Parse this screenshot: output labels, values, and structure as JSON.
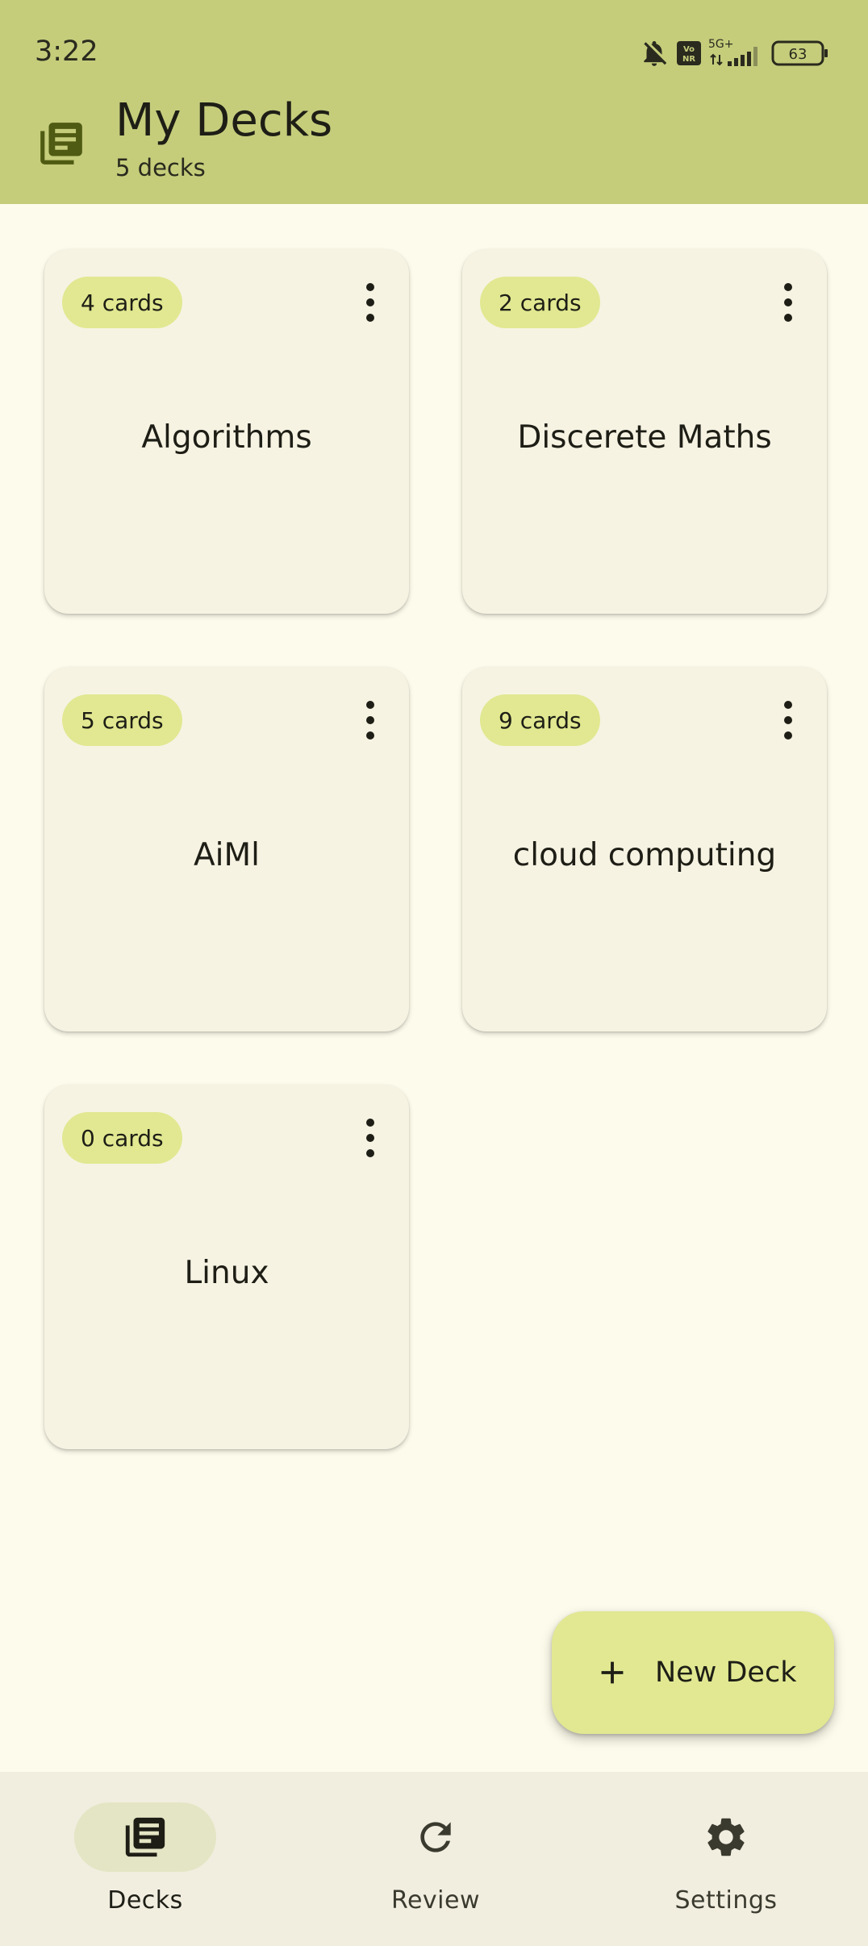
{
  "status_bar": {
    "time": "3:22",
    "network": "5G+",
    "volte": "Vo NR",
    "battery": "63",
    "icons": [
      "bell-off-icon",
      "vonr-icon",
      "signal-icon",
      "battery-icon"
    ]
  },
  "header": {
    "title": "My Decks",
    "subtitle": "5 decks",
    "icon": "library-books-icon"
  },
  "decks": [
    {
      "name": "Algorithms",
      "count": "4 cards"
    },
    {
      "name": "Discerete Maths",
      "count": "2 cards"
    },
    {
      "name": "AiMl",
      "count": "5 cards"
    },
    {
      "name": "cloud computing",
      "count": "9 cards"
    },
    {
      "name": "Linux",
      "count": "0 cards"
    }
  ],
  "fab": {
    "label": "New Deck",
    "icon": "plus-icon"
  },
  "bottom_nav": {
    "items": [
      {
        "label": "Decks",
        "icon": "library-books-icon",
        "active": true
      },
      {
        "label": "Review",
        "icon": "refresh-icon",
        "active": false
      },
      {
        "label": "Settings",
        "icon": "gear-icon",
        "active": false
      }
    ]
  },
  "colors": {
    "header_bg": "#c5cd7b",
    "page_bg": "#fdfbeb",
    "card_bg": "#f6f3e3",
    "accent": "#e1e891",
    "nav_bg": "#f1eee0"
  }
}
